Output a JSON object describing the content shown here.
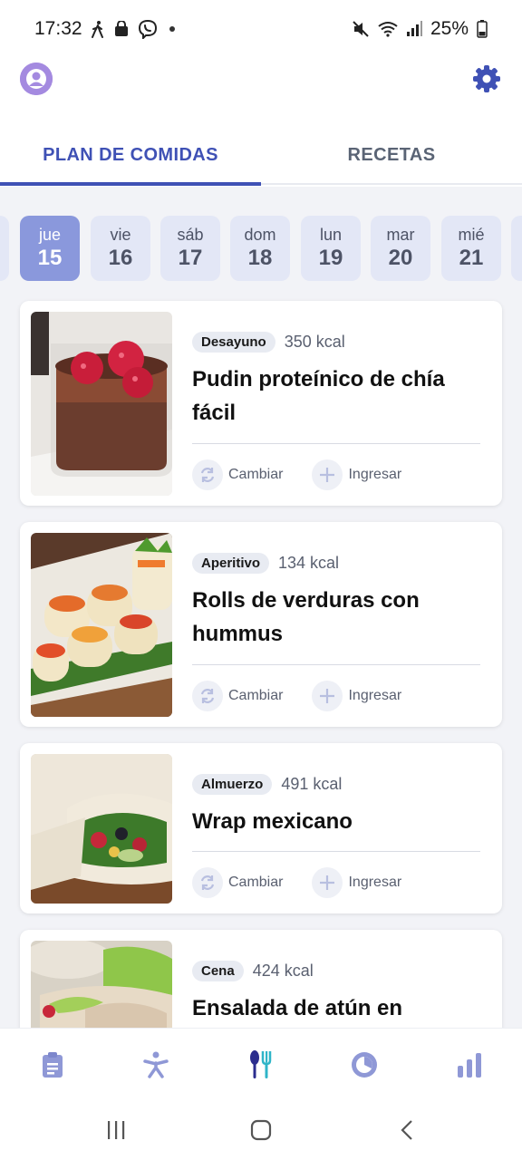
{
  "status_bar": {
    "time": "17:32",
    "battery": "25%",
    "left_icons": [
      "walking-icon",
      "shopping-bag-icon",
      "viber-icon",
      "dot-icon"
    ],
    "right_icons": [
      "mute-icon",
      "wifi-icon",
      "signal-icon",
      "battery-icon"
    ]
  },
  "top_bar": {
    "avatar_icon": "user-avatar-icon",
    "settings_icon": "gear-icon"
  },
  "tabs": [
    {
      "label": "PLAN DE COMIDAS",
      "active": true
    },
    {
      "label": "RECETAS",
      "active": false
    }
  ],
  "days": [
    {
      "name": "jue",
      "num": "15",
      "selected": true
    },
    {
      "name": "vie",
      "num": "16",
      "selected": false
    },
    {
      "name": "sáb",
      "num": "17",
      "selected": false
    },
    {
      "name": "dom",
      "num": "18",
      "selected": false
    },
    {
      "name": "lun",
      "num": "19",
      "selected": false
    },
    {
      "name": "mar",
      "num": "20",
      "selected": false
    },
    {
      "name": "mié",
      "num": "21",
      "selected": false
    }
  ],
  "meals": [
    {
      "type": "Desayuno",
      "kcal": "350 kcal",
      "title_line1": "Pudin proteínico de chía",
      "title_line2": "fácil",
      "swap_label": "Cambiar",
      "log_label": "Ingresar",
      "image_icon": "chia-pudding-photo"
    },
    {
      "type": "Aperitivo",
      "kcal": "134 kcal",
      "title_line1": "Rolls de verduras con",
      "title_line2": "hummus",
      "swap_label": "Cambiar",
      "log_label": "Ingresar",
      "image_icon": "veggie-rolls-photo"
    },
    {
      "type": "Almuerzo",
      "kcal": "491 kcal",
      "title_line1": "Wrap mexicano",
      "title_line2": "",
      "swap_label": "Cambiar",
      "log_label": "Ingresar",
      "image_icon": "mexican-wrap-photo"
    },
    {
      "type": "Cena",
      "kcal": "424 kcal",
      "title_line1": "Ensalada de atún en",
      "title_line2": "",
      "swap_label": "Cambiar",
      "log_label": "Ingresar",
      "image_icon": "tuna-salad-photo"
    }
  ],
  "bottom_nav": [
    {
      "icon": "clipboard-icon",
      "active": false
    },
    {
      "icon": "exercise-icon",
      "active": false
    },
    {
      "icon": "cutlery-icon",
      "active": true
    },
    {
      "icon": "fasting-clock-icon",
      "active": false
    },
    {
      "icon": "bar-chart-icon",
      "active": false
    }
  ],
  "system_nav": [
    "recents-icon",
    "home-icon",
    "back-icon"
  ],
  "colors": {
    "accent": "#3f51b5",
    "selected_day": "#8a98dc",
    "day_chip": "#e3e7f6",
    "background": "#f2f3f7",
    "nav_icon": "#8f98d6"
  }
}
